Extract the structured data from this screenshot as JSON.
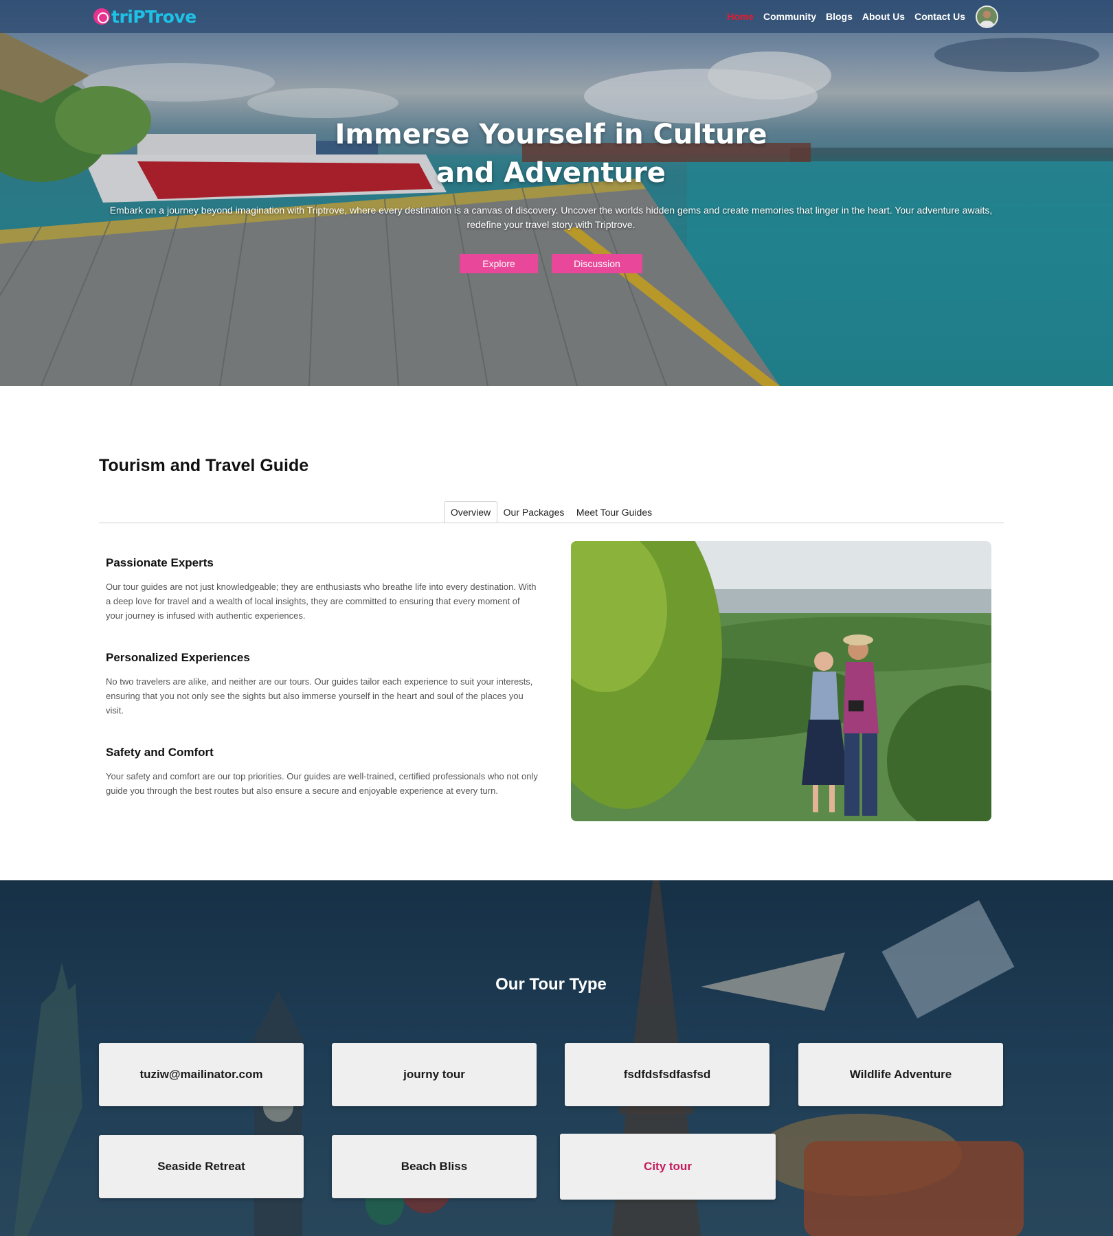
{
  "brand": {
    "name": "triPTrove",
    "color": "#1fc1e6",
    "mark_color": "#e7338f"
  },
  "nav": {
    "items": [
      {
        "label": "Home",
        "active": true
      },
      {
        "label": "Community",
        "active": false
      },
      {
        "label": "Blogs",
        "active": false
      },
      {
        "label": "About Us",
        "active": false
      },
      {
        "label": "Contact Us",
        "active": false
      }
    ],
    "active_color": "#e8192c"
  },
  "hero": {
    "title_line1": "Immerse Yourself in Culture",
    "title_line2": "and Adventure",
    "description": "Embark on a journey beyond imagination with Triptrove, where every destination is a canvas of discovery. Uncover the worlds hidden gems and create memories that linger in the heart. Your adventure awaits, redefine your travel story with Triptrove.",
    "buttons": {
      "explore": "Explore",
      "discussion": "Discussion"
    },
    "button_color": "#e8479a"
  },
  "guide": {
    "title": "Tourism and Travel Guide",
    "tabs": [
      {
        "label": "Overview",
        "active": true
      },
      {
        "label": "Our Packages",
        "active": false
      },
      {
        "label": "Meet Tour Guides",
        "active": false
      }
    ],
    "features": [
      {
        "title": "Passionate Experts",
        "text": "Our tour guides are not just knowledgeable; they are enthusiasts who breathe life into every destination. With a deep love for travel and a wealth of local insights, they are committed to ensuring that every moment of your journey is infused with authentic experiences."
      },
      {
        "title": "Personalized Experiences",
        "text": "No two travelers are alike, and neither are our tours. Our guides tailor each experience to suit your interests, ensuring that you not only see the sights but also immerse yourself in the heart and soul of the places you visit."
      },
      {
        "title": "Safety and Comfort",
        "text": "Your safety and comfort are our top priorities. Our guides are well-trained, certified professionals who not only guide you through the best routes but also ensure a secure and enjoyable experience at every turn."
      }
    ]
  },
  "tour_types": {
    "title": "Our Tour Type",
    "cards": [
      "tuziw@mailinator.com",
      "journy tour",
      "fsdfdsfsdfasfsd",
      "Wildlife Adventure",
      "Seaside Retreat",
      "Beach Bliss",
      "City tour"
    ],
    "highlight_color": "#c41a5c"
  }
}
